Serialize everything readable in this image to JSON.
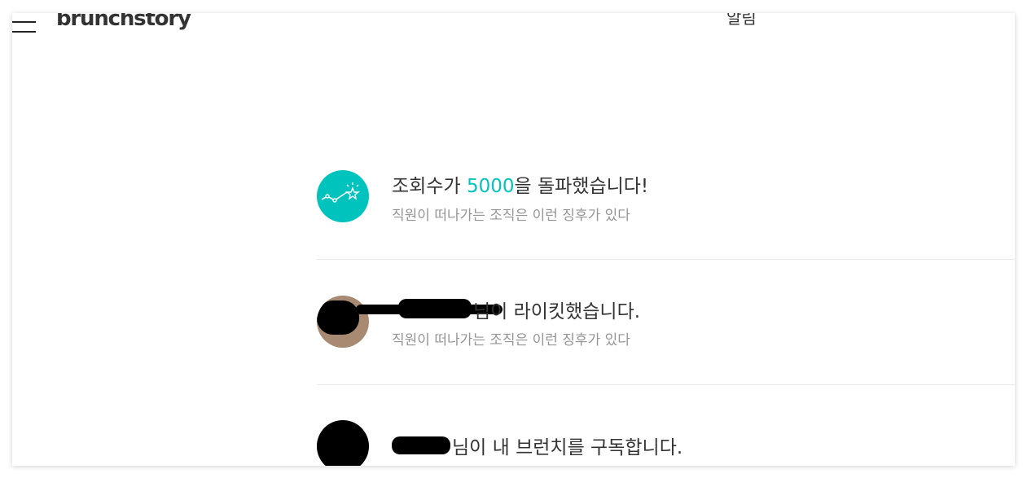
{
  "header": {
    "logo": "brunchstory",
    "title": "알림"
  },
  "notifications": [
    {
      "icon": "stats-sparkle-icon",
      "headline_prefix": "조회수가 ",
      "headline_accent": "5000",
      "headline_suffix": "을 돌파했습니다!",
      "sub": "직원이 떠나가는 조직은 이런 징후가 있다"
    },
    {
      "icon": "user-avatar",
      "headline_suffix": "님이 라이킷했습니다.",
      "sub": "직원이 떠나가는 조직은 이런 징후가 있다"
    },
    {
      "icon": "user-avatar",
      "headline_suffix": "님이 내 브런치를 구독합니다."
    }
  ],
  "colors": {
    "accent": "#00c3bd",
    "text": "#333333",
    "subtext": "#959595"
  }
}
